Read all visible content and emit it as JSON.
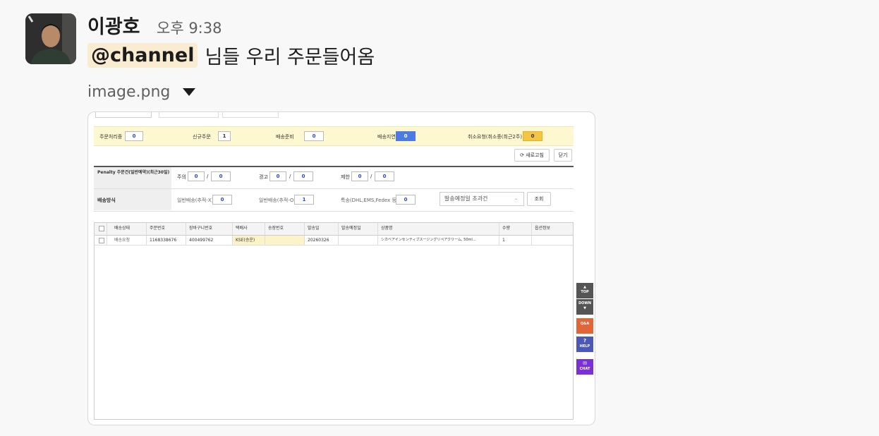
{
  "message": {
    "author": "이광호",
    "time": "오후 9:38",
    "mention": "@channel",
    "text": "님들 우리 주문들어옴",
    "file_name": "image.png"
  },
  "screenshot": {
    "status_bar": {
      "processing_label": "주문처리중",
      "processing_value": "0",
      "new_label": "신규주문",
      "new_value": "1",
      "prep_label": "배송준비",
      "prep_value": "0",
      "delay_label": "배송지연",
      "delay_value": "0",
      "cancel_label": "취소요청(취소중(최근2주)",
      "cancel_value": "0"
    },
    "refresh_label": "새로고침",
    "close_label": "닫기",
    "penalty": {
      "title": "Penalty 주문건(일반예약)(최근30일)",
      "warn1_label": "주의",
      "warn1_a": "0",
      "warn1_b": "0",
      "warn2_label": "경고",
      "warn2_a": "0",
      "warn2_b": "0",
      "warn3_label": "제한",
      "warn3_a": "0",
      "warn3_b": "0"
    },
    "shipping": {
      "title": "배송방식",
      "normal_x_label": "일반배송(추적-X)",
      "normal_x_value": "0",
      "normal_o_label": "일반배송(추적-O)",
      "normal_o_value": "1",
      "special_label": "특송(DHL,EMS,Fedex 등)",
      "special_value": "0",
      "select_value": "발송예정일 초과건",
      "search_label": "조회"
    },
    "table": {
      "headers": [
        "배송상태",
        "주문번호",
        "장바구니번호",
        "택배사",
        "송장번호",
        "발송일",
        "발송예정일",
        "상품명",
        "수량",
        "옵션정보"
      ],
      "rows": [
        [
          "배송요청",
          "1168338676",
          "400499762",
          "KSE(승운)",
          "",
          "20260326",
          "",
          "シカベアインセンティブスージングリペアクリーム, 50ml...",
          "1",
          ""
        ]
      ]
    },
    "side_buttons": {
      "top": "TOP",
      "down": "DOWN",
      "qa": "Q&A",
      "help": "HELP",
      "chat": "CHAT"
    }
  }
}
